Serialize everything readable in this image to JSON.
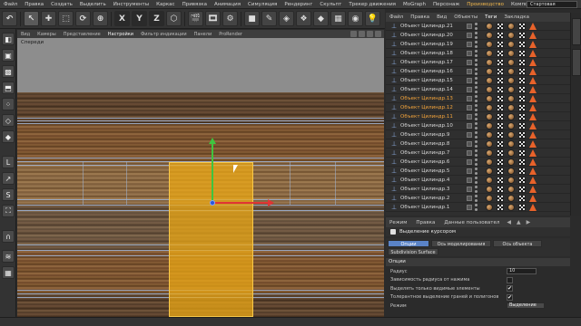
{
  "menubar": {
    "items": [
      "Файл",
      "Правка",
      "Создать",
      "Выделить",
      "Инструменты",
      "Каркас",
      "Привязка",
      "Анимация",
      "Симуляция",
      "Рендеринг",
      "Скульпт",
      "Трекер движения",
      "MoGraph",
      "Персонаж",
      "Производство",
      "Компоновка"
    ],
    "accent_index": 14,
    "layout_label": "Стартовая"
  },
  "toolbar": {
    "buttons": [
      {
        "name": "undo-icon",
        "glyph": "↶"
      },
      {
        "name": "select-arrow-icon",
        "glyph": "↖"
      },
      {
        "name": "move-icon",
        "glyph": "✚"
      },
      {
        "name": "scale-icon",
        "glyph": "⬚"
      },
      {
        "name": "rotate-icon",
        "glyph": "⟳"
      },
      {
        "name": "recent-tools-icon",
        "glyph": "⊕"
      },
      {
        "name": "x-axis-icon",
        "glyph": "X"
      },
      {
        "name": "y-axis-icon",
        "glyph": "Y"
      },
      {
        "name": "z-axis-icon",
        "glyph": "Z"
      },
      {
        "name": "coordinate-system-icon",
        "glyph": "⬡"
      },
      {
        "name": "render-view-icon",
        "glyph": "🎬"
      },
      {
        "name": "render-picture-viewer-icon",
        "glyph": "🎞"
      },
      {
        "name": "render-settings-icon",
        "glyph": "⚙"
      },
      {
        "name": "cube-icon",
        "glyph": "■"
      },
      {
        "name": "pen-icon",
        "glyph": "✎"
      },
      {
        "name": "subdivision-icon",
        "glyph": "◈"
      },
      {
        "name": "array-icon",
        "glyph": "❖"
      },
      {
        "name": "deformer-icon",
        "glyph": "◆"
      },
      {
        "name": "floor-icon",
        "glyph": "▦"
      },
      {
        "name": "camera-icon",
        "glyph": "◉"
      },
      {
        "name": "light-icon",
        "glyph": "💡"
      }
    ]
  },
  "viewport": {
    "menu": [
      "Вид",
      "Камеры",
      "Представление",
      "Настройки",
      "Фильтр индикации",
      "Панели",
      "ProRender"
    ],
    "active_index": 3,
    "label": "Спереди"
  },
  "object_manager": {
    "menu": [
      "Файл",
      "Правка",
      "Вид",
      "Объекты",
      "Теги",
      "Закладка"
    ],
    "active_index": 4,
    "rows": [
      {
        "name": "Объект Цилиндр.21",
        "orange": false
      },
      {
        "name": "Объект Цилиндр.20",
        "orange": false
      },
      {
        "name": "Объект Цилиндр.19",
        "orange": false
      },
      {
        "name": "Объект Цилиндр.18",
        "orange": false
      },
      {
        "name": "Объект Цилиндр.17",
        "orange": false
      },
      {
        "name": "Объект Цилиндр.16",
        "orange": false
      },
      {
        "name": "Объект Цилиндр.15",
        "orange": false
      },
      {
        "name": "Объект Цилиндр.14",
        "orange": false
      },
      {
        "name": "Объект Цилиндр.13",
        "orange": true
      },
      {
        "name": "Объект Цилиндр.12",
        "orange": true
      },
      {
        "name": "Объект Цилиндр.11",
        "orange": true
      },
      {
        "name": "Объект Цилиндр.10",
        "orange": false
      },
      {
        "name": "Объект Цилиндр.9",
        "orange": false
      },
      {
        "name": "Объект Цилиндр.8",
        "orange": false
      },
      {
        "name": "Объект Цилиндр.7",
        "orange": false
      },
      {
        "name": "Объект Цилиндр.6",
        "orange": false
      },
      {
        "name": "Объект Цилиндр.5",
        "orange": false
      },
      {
        "name": "Объект Цилиндр.4",
        "orange": false
      },
      {
        "name": "Объект Цилиндр.3",
        "orange": false
      },
      {
        "name": "Объект Цилиндр.2",
        "orange": false
      },
      {
        "name": "Объект Цилиндр.1",
        "orange": false
      }
    ]
  },
  "attributes": {
    "menu": [
      "Режим",
      "Правка",
      "Данные пользовател"
    ],
    "tool_title": "Выделение курсором",
    "tabs": [
      "Опции",
      "Ось моделирования",
      "Ось объекта",
      "Subdivision Surface"
    ],
    "active_tab": 0,
    "section": "Опции",
    "props": [
      {
        "label": "Радиус",
        "type": "value",
        "value": "10"
      },
      {
        "label": "Зависимость радиуса от нажима",
        "type": "check",
        "value": ""
      },
      {
        "label": "Выделять только видимые элементы",
        "type": "check",
        "value": "✔"
      },
      {
        "label": "Толерантное выделение граней и полигонов",
        "type": "check",
        "value": "✔"
      },
      {
        "label": "Режим",
        "type": "dropdown",
        "value": "Выделение"
      }
    ]
  }
}
